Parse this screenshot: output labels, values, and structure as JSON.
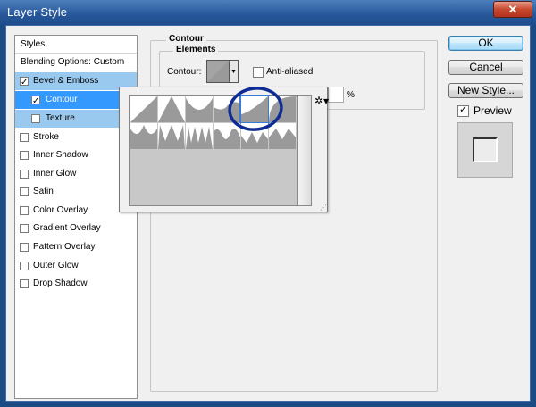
{
  "window": {
    "title": "Layer Style",
    "close_glyph": "✕"
  },
  "styles_panel": {
    "header": "Styles",
    "blending": "Blending Options: Custom",
    "items": [
      {
        "label": "Bevel & Emboss",
        "checked": true
      },
      {
        "label": "Contour",
        "checked": true
      },
      {
        "label": "Texture",
        "checked": false
      },
      {
        "label": "Stroke",
        "checked": false
      },
      {
        "label": "Inner Shadow",
        "checked": false
      },
      {
        "label": "Inner Glow",
        "checked": false
      },
      {
        "label": "Satin",
        "checked": false
      },
      {
        "label": "Color Overlay",
        "checked": false
      },
      {
        "label": "Gradient Overlay",
        "checked": false
      },
      {
        "label": "Pattern Overlay",
        "checked": false
      },
      {
        "label": "Outer Glow",
        "checked": false
      },
      {
        "label": "Drop Shadow",
        "checked": false
      }
    ]
  },
  "contour_panel": {
    "group_title": "Contour",
    "elements_title": "Elements",
    "contour_label": "Contour:",
    "antialiased_label": "Anti-aliased",
    "antialiased_checked": false,
    "range_unit": "%",
    "picker_menu_icon": "gear-icon",
    "annotation_color": "#0f2c94"
  },
  "buttons": {
    "ok": "OK",
    "cancel": "Cancel",
    "new_style": "New Style..."
  },
  "preview": {
    "label": "Preview",
    "checked": true
  },
  "colors": {
    "selected_row": "#3399ff",
    "selected_parent": "#99c9ef",
    "titlebar": "#2a5a9c"
  }
}
